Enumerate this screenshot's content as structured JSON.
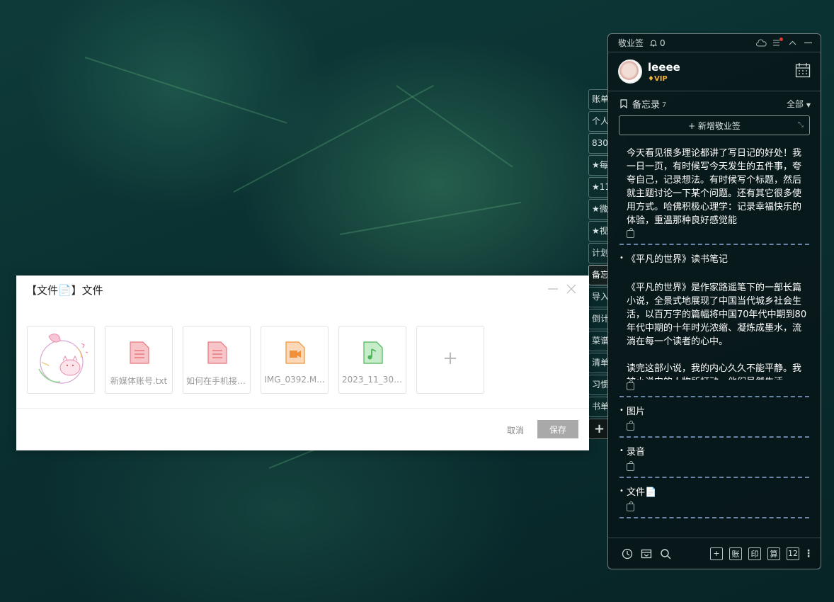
{
  "side_tabs": [
    "账单",
    "个人",
    "830",
    "★每",
    "★11",
    "★微",
    "★视",
    "计划",
    "备忘",
    "导入",
    "倒计",
    "菜谱",
    "清单",
    "习惯",
    "书单",
    "+"
  ],
  "panel": {
    "app_name": "敬业签",
    "notifications": "0",
    "user": {
      "name": "leeee",
      "badge": "VIP"
    },
    "memo_section": {
      "title": "备忘录",
      "count": "7",
      "filter": "全部"
    },
    "new_button": "+ 新增敬业签",
    "notes": [
      {
        "title": "",
        "body": "今天看见很多理论都讲了写日记的好处！我一日一页，有时候写今天发生的五件事，夸夸自己，记录想法。有时候写个标题，然后就主题讨论一下某个问题。还有其它很多使用方式。哈佛积极心理学：记录幸福快乐的体验，重温那种良好感觉能"
      },
      {
        "title": "《平凡的世界》读书笔记",
        "body": "\n《平凡的世界》是作家路遥笔下的一部长篇小说，全景式地展现了中国当代城乡社会生活，以百万字的篇幅将中国70年代中期到80年代中期的十年时光浓缩、凝炼成墨水，流淌在每一个读者的心中。\n\n读完这部小说，我的内心久久不能平静。我被小说中的人物所打动，他们虽然生活"
      },
      {
        "title": "图片",
        "body": ""
      },
      {
        "title": "录音",
        "body": ""
      },
      {
        "title": "文件📄",
        "body": ""
      }
    ],
    "bottom": {
      "boxes": [
        "+",
        "账",
        "印",
        "算",
        "12"
      ]
    }
  },
  "dialog": {
    "title": "【文件📄】文件",
    "files": [
      {
        "name": "",
        "type": "image"
      },
      {
        "name": "新媒体账号.txt",
        "type": "txt"
      },
      {
        "name": "如何在手机接收...",
        "type": "txt"
      },
      {
        "name": "IMG_0392.M...",
        "type": "video"
      },
      {
        "name": "2023_11_30_0...",
        "type": "audio"
      }
    ],
    "cancel": "取消",
    "save": "保存"
  }
}
